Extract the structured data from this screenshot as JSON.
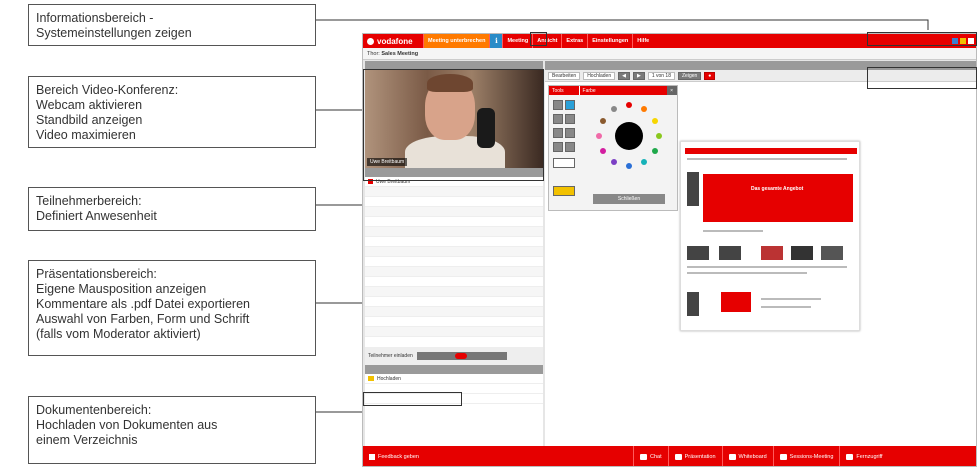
{
  "callouts": [
    {
      "id": "info",
      "lines": [
        "Informationsbereich -",
        "Systemeinstellungen zeigen"
      ]
    },
    {
      "id": "video",
      "lines": [
        "Bereich Video-Konferenz:",
        "Webcam aktivieren",
        "Standbild anzeigen",
        "Video maximieren"
      ]
    },
    {
      "id": "participants",
      "lines": [
        "Teilnehmerbereich:",
        "Definiert Anwesenheit"
      ]
    },
    {
      "id": "presentation",
      "lines": [
        "Präsentationsbereich:",
        "Eigene Mausposition anzeigen",
        "Kommentare als .pdf Datei exportieren",
        "Auswahl von Farben, Form und Schrift",
        "(falls vom Moderator aktiviert)"
      ]
    },
    {
      "id": "documents",
      "lines": [
        "Dokumentenbereich:",
        "Hochladen von Dokumenten aus",
        "einem Verzeichnis"
      ]
    }
  ],
  "app": {
    "brand": "vodafone",
    "menu": [
      "Meeting unterbrechen",
      "Meeting",
      "Ansicht",
      "Extras",
      "Einstellungen",
      "Hilfe"
    ],
    "meeting_label": "Thor:",
    "meeting_name": "Sales Meeting",
    "video_caption": "Uwe Breitbaum",
    "participant": "Uwe Breitbaum",
    "pres_toolbar": {
      "btn_draw": "Bearbeiten",
      "btn_upload": "Hochladen",
      "page_indicator": "1 von 18",
      "btn_zoom": "Zeigen"
    },
    "palette_tabs": [
      "Tools",
      "Farbe"
    ],
    "palette_button": "Schließen",
    "doc_item": "Hochladen",
    "invite_label": "Teilnehmer einladen",
    "slide_hero": "Das gesamte Angebot",
    "footer": {
      "feedback": "Feedback geben",
      "buttons": [
        "Chat",
        "Präsentation",
        "Whiteboard",
        "Sessions-Meeting",
        "Fernzugriff"
      ]
    }
  },
  "colors": {
    "brand_red": "#e60000",
    "accent_orange": "#ff7a00",
    "info_blue": "#2a8cc8"
  }
}
